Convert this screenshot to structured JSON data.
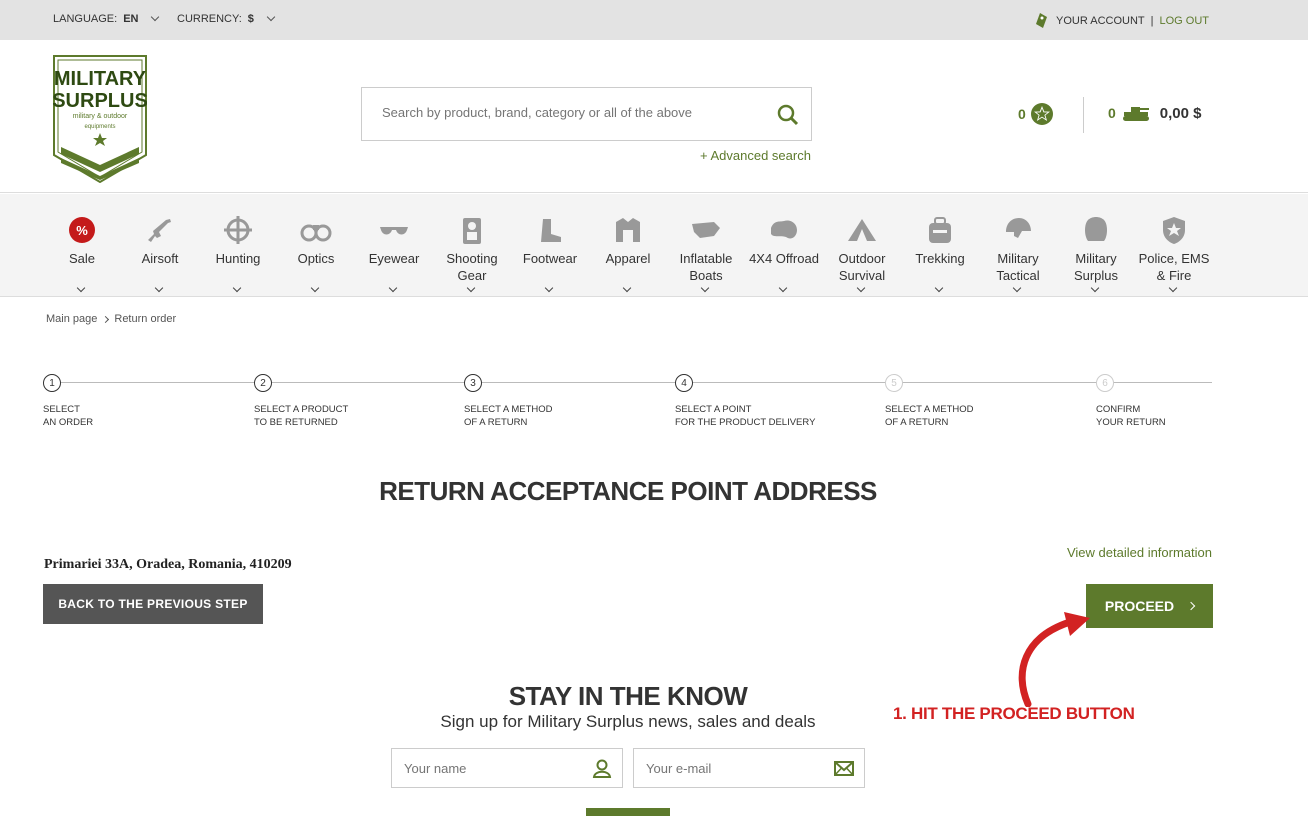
{
  "topbar": {
    "language_label": "LANGUAGE:",
    "language_value": "EN",
    "currency_label": "CURRENCY:",
    "currency_value": "$",
    "account_label": "YOUR ACCOUNT",
    "separator": "|",
    "logout_label": "LOG OUT"
  },
  "logo": {
    "line1": "MILITARY",
    "line2": "SURPLUS",
    "line3": "military & outdoor",
    "line4": "equipments"
  },
  "search": {
    "placeholder": "Search by product, brand, category or all of the above",
    "advanced_label": "+ Advanced search"
  },
  "wishlist": {
    "count": "0"
  },
  "cart": {
    "count": "0",
    "total": "0,00 $"
  },
  "nav": {
    "items": [
      {
        "label": "Sale",
        "icon": "sale-percent-icon"
      },
      {
        "label": "Airsoft",
        "icon": "rifle-icon"
      },
      {
        "label": "Hunting",
        "icon": "crosshair-icon"
      },
      {
        "label": "Optics",
        "icon": "binoculars-icon"
      },
      {
        "label": "Eyewear",
        "icon": "sunglasses-icon"
      },
      {
        "label": "Shooting Gear",
        "icon": "target-gear-icon"
      },
      {
        "label": "Footwear",
        "icon": "boot-icon"
      },
      {
        "label": "Apparel",
        "icon": "jacket-icon"
      },
      {
        "label": "Inflatable Boats",
        "icon": "boat-icon"
      },
      {
        "label": "4X4 Offroad",
        "icon": "offroad-icon"
      },
      {
        "label": "Outdoor Survival",
        "icon": "tent-icon"
      },
      {
        "label": "Trekking",
        "icon": "backpack-icon"
      },
      {
        "label": "Military Tactical",
        "icon": "helmet-icon"
      },
      {
        "label": "Military Surplus",
        "icon": "surplus-icon"
      },
      {
        "label": "Police, EMS & Fire",
        "icon": "badge-icon"
      }
    ]
  },
  "breadcrumb": {
    "home": "Main page",
    "current": "Return order"
  },
  "steps": [
    {
      "num": "1",
      "line1": "SELECT",
      "line2": "AN ORDER",
      "active": true
    },
    {
      "num": "2",
      "line1": "SELECT A PRODUCT",
      "line2": "TO BE RETURNED",
      "active": true
    },
    {
      "num": "3",
      "line1": "SELECT A METHOD",
      "line2": "OF A RETURN",
      "active": true
    },
    {
      "num": "4",
      "line1": "SELECT A POINT",
      "line2": "FOR THE PRODUCT DELIVERY",
      "active": true
    },
    {
      "num": "5",
      "line1": "SELECT A METHOD",
      "line2": "OF A RETURN",
      "active": false
    },
    {
      "num": "6",
      "line1": "CONFIRM",
      "line2": "YOUR RETURN",
      "active": false
    }
  ],
  "main": {
    "title": "RETURN ACCEPTANCE POINT ADDRESS",
    "view_info": "View detailed information",
    "address": "Primariei 33A, Oradea, Romania, 410209",
    "back_button": "BACK TO THE PREVIOUS STEP",
    "proceed_button": "PROCEED"
  },
  "annotation": {
    "text": "1. HIT THE PROCEED BUTTON",
    "color": "#d22222"
  },
  "newsletter": {
    "title": "STAY IN THE KNOW",
    "subtitle": "Sign up for Military Surplus news, sales and deals",
    "name_placeholder": "Your name",
    "email_placeholder": "Your e-mail"
  },
  "colors": {
    "accent": "#5d7a2c",
    "dark_button": "#555555",
    "annotation": "#d22222"
  }
}
